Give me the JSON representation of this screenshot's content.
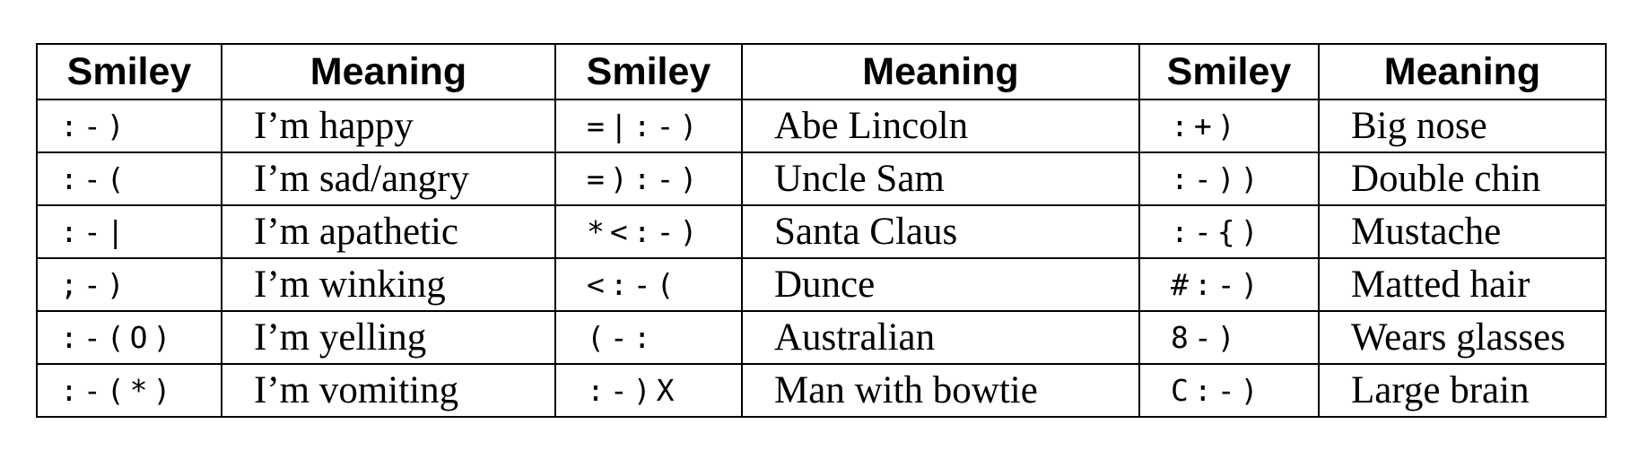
{
  "table": {
    "headers": [
      "Smiley",
      "Meaning",
      "Smiley",
      "Meaning",
      "Smiley",
      "Meaning"
    ],
    "rows": [
      [
        ":-)",
        "I’m happy",
        "=|:-)",
        "Abe Lincoln",
        ":+)",
        "Big nose"
      ],
      [
        ":-(",
        "I’m sad/angry",
        "=):-)",
        "Uncle Sam",
        ":-))",
        "Double chin"
      ],
      [
        ":-|",
        "I’m apathetic",
        "*<:-)",
        "Santa Claus",
        ":-{)",
        "Mustache"
      ],
      [
        ";-)",
        "I’m winking",
        "<:-(",
        "Dunce",
        "#:-)",
        "Matted hair"
      ],
      [
        ":-(O)",
        "I’m yelling",
        "(-:",
        "Australian",
        "8-)",
        "Wears glasses"
      ],
      [
        ":-(*)",
        "I’m vomiting",
        ":-)X",
        "Man with bowtie",
        "C:-)",
        "Large brain"
      ]
    ]
  }
}
